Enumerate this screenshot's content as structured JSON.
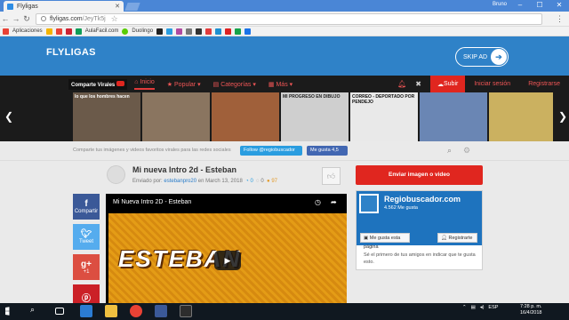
{
  "browser": {
    "tab_title": "Flyligas",
    "user": "Bruno",
    "url_domain": "flyligas.com",
    "url_path": "/JeyTk5j",
    "bookmarks": [
      "Aplicaciones",
      "AulaFacil.com",
      "Duolingo"
    ]
  },
  "hero": {
    "logo": "FLYLIGAS",
    "skip": "SKIP AD"
  },
  "nav": {
    "brand": "Comparte Virales",
    "items": [
      "Inicio",
      "Popular",
      "Categorías",
      "Más"
    ],
    "upload": "Subir",
    "login": "Iniciar sesión",
    "register": "Registrarse"
  },
  "thumbs": [
    {
      "caption": "lo que los hombres hacen",
      "color": "#6b5a4a"
    },
    {
      "caption": "",
      "color": "#8a7560"
    },
    {
      "caption": "",
      "color": "#b06c4a"
    },
    {
      "caption": "MI PROGRESO EN DIBUJO",
      "color": "#cfcfcf"
    },
    {
      "caption": "CORREO - DEPORTADO POR PENDEJO",
      "color": "#e9e9e9"
    },
    {
      "caption": "",
      "color": "#6a86b4"
    }
  ],
  "tagline": {
    "text": "Comparte tus imágenes y videos favoritos virales para las redes sociales",
    "twitter": "Follow @regiobuscador",
    "facebook": "Me gusta 4,5"
  },
  "post": {
    "title": "Mi nueva Intro 2d - Esteban",
    "sent_by": "Enviado por:",
    "author": "estebanpro20",
    "date": "en March 13, 2018",
    "c1": "0",
    "c2": "0",
    "c3": "97"
  },
  "share": {
    "facebook": "Compartir",
    "twitter": "Tweet",
    "gplus": "+1"
  },
  "video": {
    "title": "Mi Nueva Intro 2D - Esteban",
    "art_word": "ESTEBAN"
  },
  "sidebar": {
    "send": "Enviar imagen o video",
    "fb_name": "Regiobuscador.com",
    "fb_likes": "4.562 Me gusta",
    "fb_like_btn": "Me gusta esta página",
    "fb_reg": "Registrarte",
    "fb_friends": "Sé el primero de tus amigos en indicar que te gusta esto."
  },
  "taskbar": {
    "time": "7:28 p. m.",
    "date": "16/4/2018",
    "lang": "ESP"
  }
}
